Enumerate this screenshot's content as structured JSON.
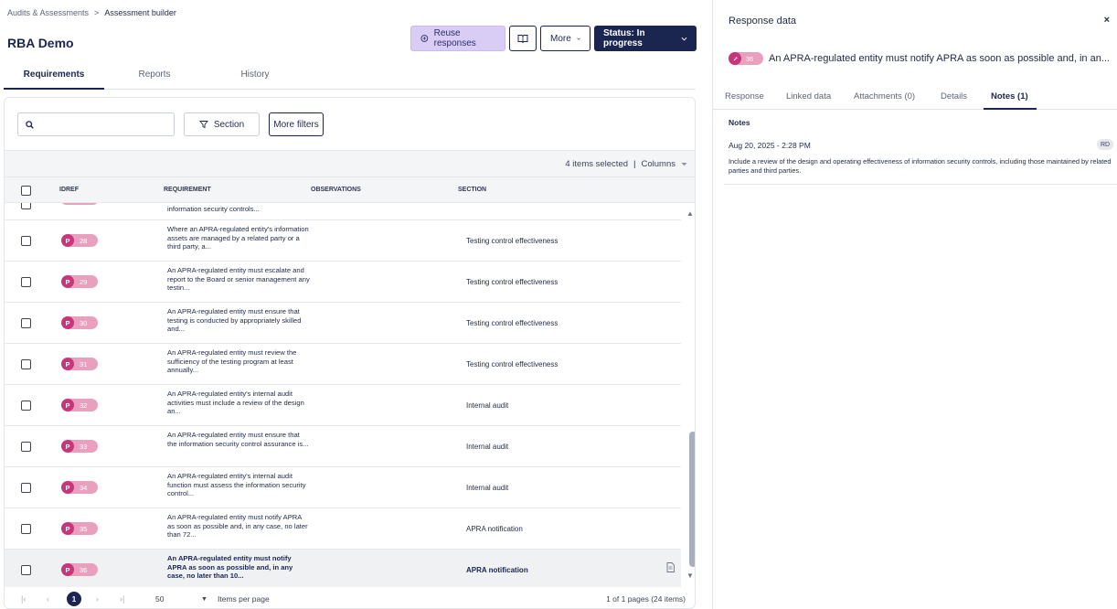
{
  "breadcrumb": {
    "parent": "Audits & Assessments",
    "separator": ">",
    "current": "Assessment builder"
  },
  "page": {
    "title": "RBA Demo"
  },
  "actions": {
    "reuse_label": "Reuse responses",
    "more_label": "More",
    "status_label": "Status: In progress"
  },
  "tabs": [
    "Requirements",
    "Reports",
    "History"
  ],
  "filters": {
    "search_placeholder": "",
    "section_label": "Section",
    "more_filters_label": "More filters"
  },
  "selection": {
    "selected_text": "4 items selected",
    "separator": "|",
    "columns_label": "Columns"
  },
  "table": {
    "headers": {
      "idref": "IDREF",
      "requirement": "REQUIREMENT",
      "observations": "OBSERVATIONS",
      "section": "SECTION"
    },
    "partial_row": {
      "requirement": "information security controls..."
    },
    "rows": [
      {
        "prefix": "P",
        "num": "28",
        "requirement": "Where an APRA-regulated entity's information assets are managed by a related party or a third party, a...",
        "section": "Testing control effectiveness"
      },
      {
        "prefix": "P",
        "num": "29",
        "requirement": "An APRA-regulated entity must escalate and report to the Board or senior management any testin...",
        "section": "Testing control effectiveness"
      },
      {
        "prefix": "P",
        "num": "30",
        "requirement": "An APRA-regulated entity must ensure that testing is conducted by appropriately skilled and...",
        "section": "Testing control effectiveness"
      },
      {
        "prefix": "P",
        "num": "31",
        "requirement": "An APRA-regulated entity must review the sufficiency of the testing program at least annually...",
        "section": "Testing control effectiveness"
      },
      {
        "prefix": "P",
        "num": "32",
        "requirement": "An APRA-regulated entity's internal audit activities must include a review of the design an...",
        "section": "Internal audit"
      },
      {
        "prefix": "P",
        "num": "33",
        "requirement": "An APRA-regulated entity must ensure that the information security control assurance is...",
        "section": "Internal audit"
      },
      {
        "prefix": "P",
        "num": "34",
        "requirement": "An APRA-regulated entity's internal audit function must assess the information security control...",
        "section": "Internal audit"
      },
      {
        "prefix": "P",
        "num": "35",
        "requirement": "An APRA-regulated entity must notify APRA as soon as possible and, in any case, no later than 72...",
        "section": "APRA notification"
      },
      {
        "prefix": "P",
        "num": "36",
        "requirement": "An APRA-regulated entity must notify APRA as soon as possible and, in any case, no later than 10...",
        "section": "APRA notification"
      }
    ]
  },
  "pager": {
    "current_page": "1",
    "per_page": "50",
    "per_page_label": "Items per page",
    "summary": "1 of 1 pages (24 items)"
  },
  "panel": {
    "title": "Response data",
    "close": "×",
    "req_prefix": "P",
    "req_num": "36",
    "req_text": "An APRA-regulated entity must notify APRA as soon as possible and, in an...",
    "tabs": [
      "Response",
      "Linked data",
      "Attachments (0)",
      "Details",
      "Notes (1)"
    ],
    "notes_heading": "Notes",
    "note": {
      "date": "Aug 20, 2025 - 2:28 PM",
      "author_initials": "RD",
      "text": "Include a review of the design and operating effectiveness of information security controls, including those maintained by related parties and third parties."
    }
  },
  "colors": {
    "brand_navy": "#1a2550",
    "badge_pink": "#e9a0bf",
    "badge_magenta": "#c8357a",
    "reuse_lavender": "#d9ccf5"
  }
}
